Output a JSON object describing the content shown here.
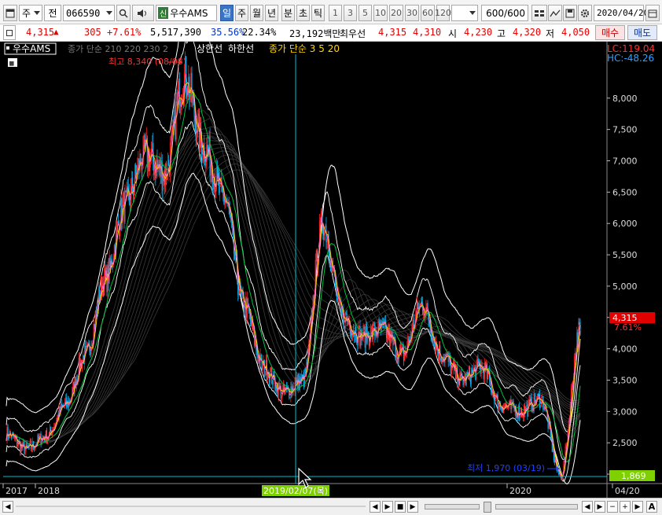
{
  "toolbar": {
    "market_type": "주",
    "market_scope": "전",
    "stock_code": "066590",
    "sin_badge": "신",
    "stock_name": "우수AMS",
    "periods": [
      "일",
      "주",
      "월",
      "년",
      "분",
      "초",
      "틱"
    ],
    "active_period": "일",
    "intervals": [
      "1",
      "3",
      "5",
      "10",
      "20",
      "30",
      "60",
      "120"
    ],
    "range_display": "600",
    "range_total": "/600",
    "date": "2020/04/20"
  },
  "quote": {
    "price": "4,315",
    "direction": "▲",
    "change": "305",
    "change_pct": "+7.61%",
    "volume": "5,517,390",
    "vol_ratio": "35.56%",
    "turnover": "22.34%",
    "amount": "23,192백만",
    "prev_label": "최우선",
    "best_ask": "4,315",
    "best_bid": "4,310",
    "open_label": "시",
    "open": "4,230",
    "high_label": "고",
    "high": "4,320",
    "low_label": "저",
    "low": "4,050",
    "buy_label": "매수",
    "sell_label": "매도"
  },
  "legend": {
    "name": "우수AMS",
    "ma_partial": "종가 단순 210 220 230 2",
    "upper": "상한선",
    "lower": "하한선",
    "short_ma": "종가 단순 3 5 20"
  },
  "annotations": {
    "lc": "LC:119.04",
    "hc": "HC:-48.26",
    "high_note": "최고 8,340 (08/08)",
    "low_note": "최저 1,970 (03/19)",
    "price_tag": "4,315",
    "pct_tag": "7.61%",
    "cross_tag": "1,869",
    "cross_date": "2019/02/07(목)"
  },
  "colors": {
    "up": "#ff2020",
    "down": "#00b0f0",
    "envelope": "#ffffff",
    "ribbon": "#3a3a3a",
    "ma5": "#ffd400",
    "ma20": "#00c040",
    "crosshair": "#00c0d0",
    "price_tag_bg": "#e00000",
    "cross_tag_bg": "#7ed000"
  },
  "chart_data": {
    "type": "line",
    "ylim": [
      1850,
      8700
    ],
    "yticks": [
      "8,000",
      "7,500",
      "7,000",
      "6,500",
      "6,000",
      "5,500",
      "5,000",
      "4,500",
      "4,000",
      "3,500",
      "3,000",
      "2,500",
      "2,000"
    ],
    "x_labels": [
      "2017",
      "2018",
      "2019/02/07(목)",
      "2020",
      "04/20"
    ],
    "series": [
      {
        "name": "우수AMS",
        "x": [
          "2017-11",
          "2017-12",
          "2018-01",
          "2018-02",
          "2018-03",
          "2018-04",
          "2018-05",
          "2018-06",
          "2018-07",
          "2018-08",
          "2018-09",
          "2018-10",
          "2018-11",
          "2018-12",
          "2019-01",
          "2019-02",
          "2019-03",
          "2019-04",
          "2019-05",
          "2019-06",
          "2019-07",
          "2019-08",
          "2019-09",
          "2019-10",
          "2019-11",
          "2019-12",
          "2020-01",
          "2020-02",
          "2020-03",
          "2020-04"
        ],
        "values": [
          2650,
          2400,
          2600,
          3100,
          3900,
          5100,
          6300,
          7100,
          6800,
          8340,
          7200,
          6400,
          4700,
          3700,
          3300,
          3500,
          6000,
          4500,
          4200,
          4300,
          3900,
          4700,
          3900,
          3500,
          3700,
          3100,
          3000,
          3200,
          1970,
          4315
        ]
      }
    ]
  }
}
